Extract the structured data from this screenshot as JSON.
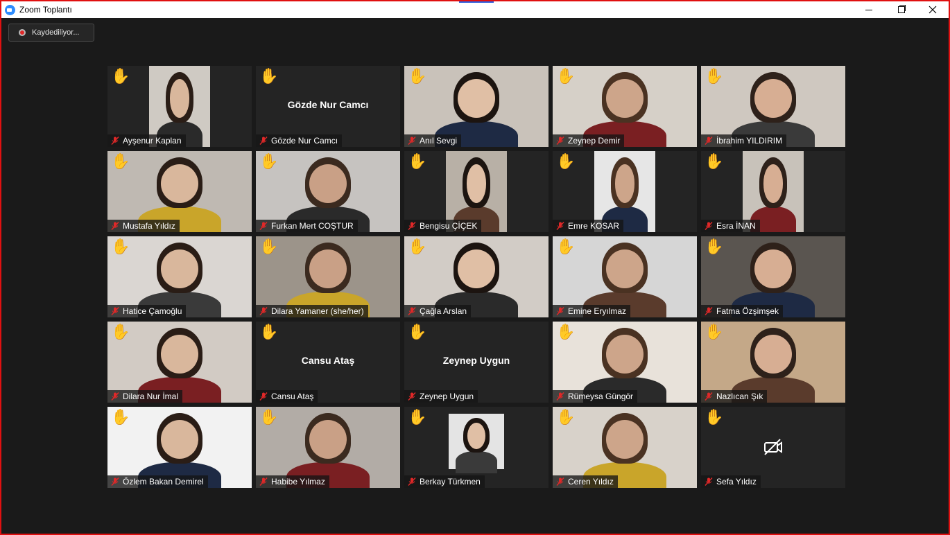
{
  "window": {
    "title": "Zoom Toplantı",
    "recording_label": "Kaydediliyor..."
  },
  "colors": {
    "accent": "#2d8cff",
    "recording_red": "#e02828",
    "mic_off_red": "#e02828",
    "frame_red": "#e01010",
    "raise_hand_yellow": "#f5c518",
    "raise_hand_light": "#f4d2b0"
  },
  "participants": [
    {
      "name": "Ayşenur Kaplan",
      "video": "narrow",
      "hand": "yellow",
      "muted": true,
      "bg": "#cfcac3"
    },
    {
      "name": "Gözde Nur Camcı",
      "video": "off-name",
      "hand": "yellow",
      "muted": true,
      "display_name": "Gözde Nur Camcı"
    },
    {
      "name": "Anıl Sevgi",
      "video": "full",
      "hand": "yellow",
      "muted": true,
      "bg": "#c9c2ba"
    },
    {
      "name": "Zeynep Demir",
      "video": "full",
      "hand": "yellow",
      "muted": true,
      "bg": "#d6d0c8"
    },
    {
      "name": "İbrahim YILDIRIM",
      "video": "full",
      "hand": "yellow",
      "muted": true,
      "bg": "#cfc8c0"
    },
    {
      "name": "Mustafa Yıldız",
      "video": "full",
      "hand": "yellow",
      "muted": true,
      "bg": "#bfb9b2"
    },
    {
      "name": "Furkan Mert COŞTUR",
      "video": "full",
      "hand": "yellow",
      "muted": true,
      "bg": "#c6c3c0"
    },
    {
      "name": "Bengisu ÇİÇEK",
      "video": "narrow",
      "hand": "yellow",
      "muted": true,
      "bg": "#b8b0a6"
    },
    {
      "name": "Emre KOSAR",
      "video": "narrow",
      "hand": "yellow",
      "muted": true,
      "bg": "#e6e6e6"
    },
    {
      "name": "Esra İNAN",
      "video": "narrow",
      "hand": "yellow",
      "muted": true,
      "bg": "#c8c2ba"
    },
    {
      "name": "Hatice Çamoğlu",
      "video": "full",
      "hand": "yellow",
      "muted": true,
      "bg": "#dad6d2"
    },
    {
      "name": "Dilara Yamaner (she/her)",
      "video": "full",
      "hand": "yellow",
      "muted": true,
      "bg": "#9c948a"
    },
    {
      "name": "Çağla Arslan",
      "video": "full",
      "hand": "yellow",
      "muted": true,
      "bg": "#d2ccc6"
    },
    {
      "name": "Emine Eryılmaz",
      "video": "full",
      "hand": "yellow",
      "muted": true,
      "bg": "#d6d6d6"
    },
    {
      "name": "Fatma Özşimşek",
      "video": "full",
      "hand": "yellow",
      "muted": true,
      "bg": "#5a5550"
    },
    {
      "name": "Dilara Nur İmal",
      "video": "full",
      "hand": "yellow",
      "muted": true,
      "bg": "#d2cbc4"
    },
    {
      "name": "Cansu Ataş",
      "video": "off-name",
      "hand": "yellow",
      "muted": true,
      "display_name": "Cansu Ataş"
    },
    {
      "name": "Zeynep Uygun",
      "video": "off-name",
      "hand": "yellow",
      "muted": true,
      "display_name": "Zeynep Uygun"
    },
    {
      "name": "Rümeysa Güngör",
      "video": "full",
      "hand": "light",
      "muted": true,
      "bg": "#e8e2da"
    },
    {
      "name": "Nazlıcan Şık",
      "video": "full",
      "hand": "light",
      "muted": true,
      "bg": "#c4a888"
    },
    {
      "name": "Özlem Bakan Demirel",
      "video": "full",
      "hand": "light",
      "muted": true,
      "bg": "#f2f2f2"
    },
    {
      "name": "Habibe Yılmaz",
      "video": "full",
      "hand": "yellow",
      "muted": true,
      "bg": "#b2aca6"
    },
    {
      "name": "Berkay Türkmen",
      "video": "square",
      "hand": "yellow",
      "muted": true,
      "bg": "#e4e4e4"
    },
    {
      "name": "Ceren Yıldız",
      "video": "full",
      "hand": "yellow",
      "muted": true,
      "bg": "#d8d2ca"
    },
    {
      "name": "Sefa Yıldız",
      "video": "camera-off",
      "hand": "light",
      "muted": true
    }
  ]
}
